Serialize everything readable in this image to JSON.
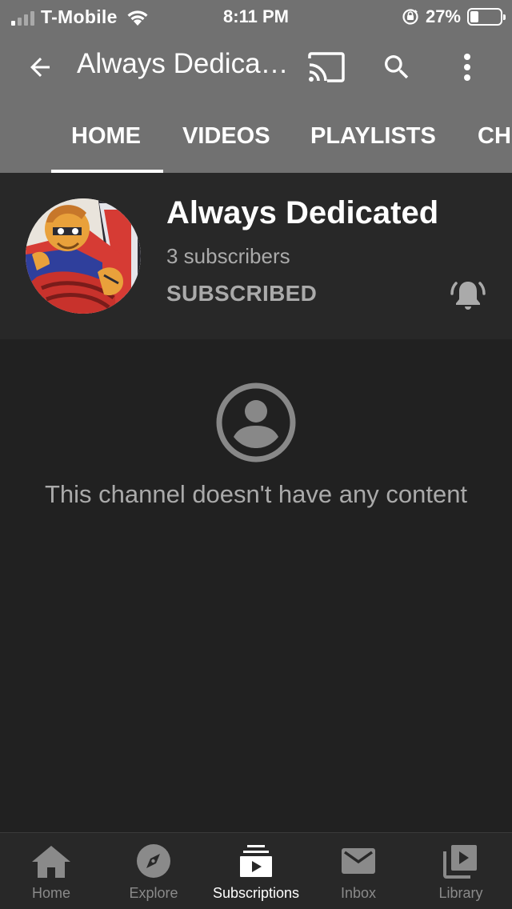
{
  "status_bar": {
    "carrier": "T-Mobile",
    "time": "8:11 PM",
    "battery_percent": "27%",
    "battery_level": 0.27,
    "signal_bars_filled": 1
  },
  "app_bar": {
    "title": "Always Dedica…",
    "icons": [
      "back-arrow-icon",
      "cast-icon",
      "search-icon",
      "more-vert-icon"
    ]
  },
  "tabs": [
    {
      "label": "HOME",
      "active": true
    },
    {
      "label": "VIDEOS",
      "active": false
    },
    {
      "label": "PLAYLISTS",
      "active": false
    },
    {
      "label": "CH",
      "active": false
    }
  ],
  "channel": {
    "name": "Always Dedicated",
    "subscribers": "3 subscribers",
    "subscribe_state": "SUBSCRIBED"
  },
  "empty_state": {
    "message": "This channel doesn't have any content",
    "icon": "account-circle-icon"
  },
  "bottom_nav": [
    {
      "label": "Home",
      "icon": "home-icon",
      "active": false
    },
    {
      "label": "Explore",
      "icon": "compass-icon",
      "active": false
    },
    {
      "label": "Subscriptions",
      "icon": "subscriptions-icon",
      "active": true
    },
    {
      "label": "Inbox",
      "icon": "mail-icon",
      "active": false
    },
    {
      "label": "Library",
      "icon": "library-icon",
      "active": false
    }
  ],
  "colors": {
    "app_bar": "#717171",
    "background": "#212121",
    "header_bg": "#282828",
    "secondary_text": "#aaaaaa"
  }
}
